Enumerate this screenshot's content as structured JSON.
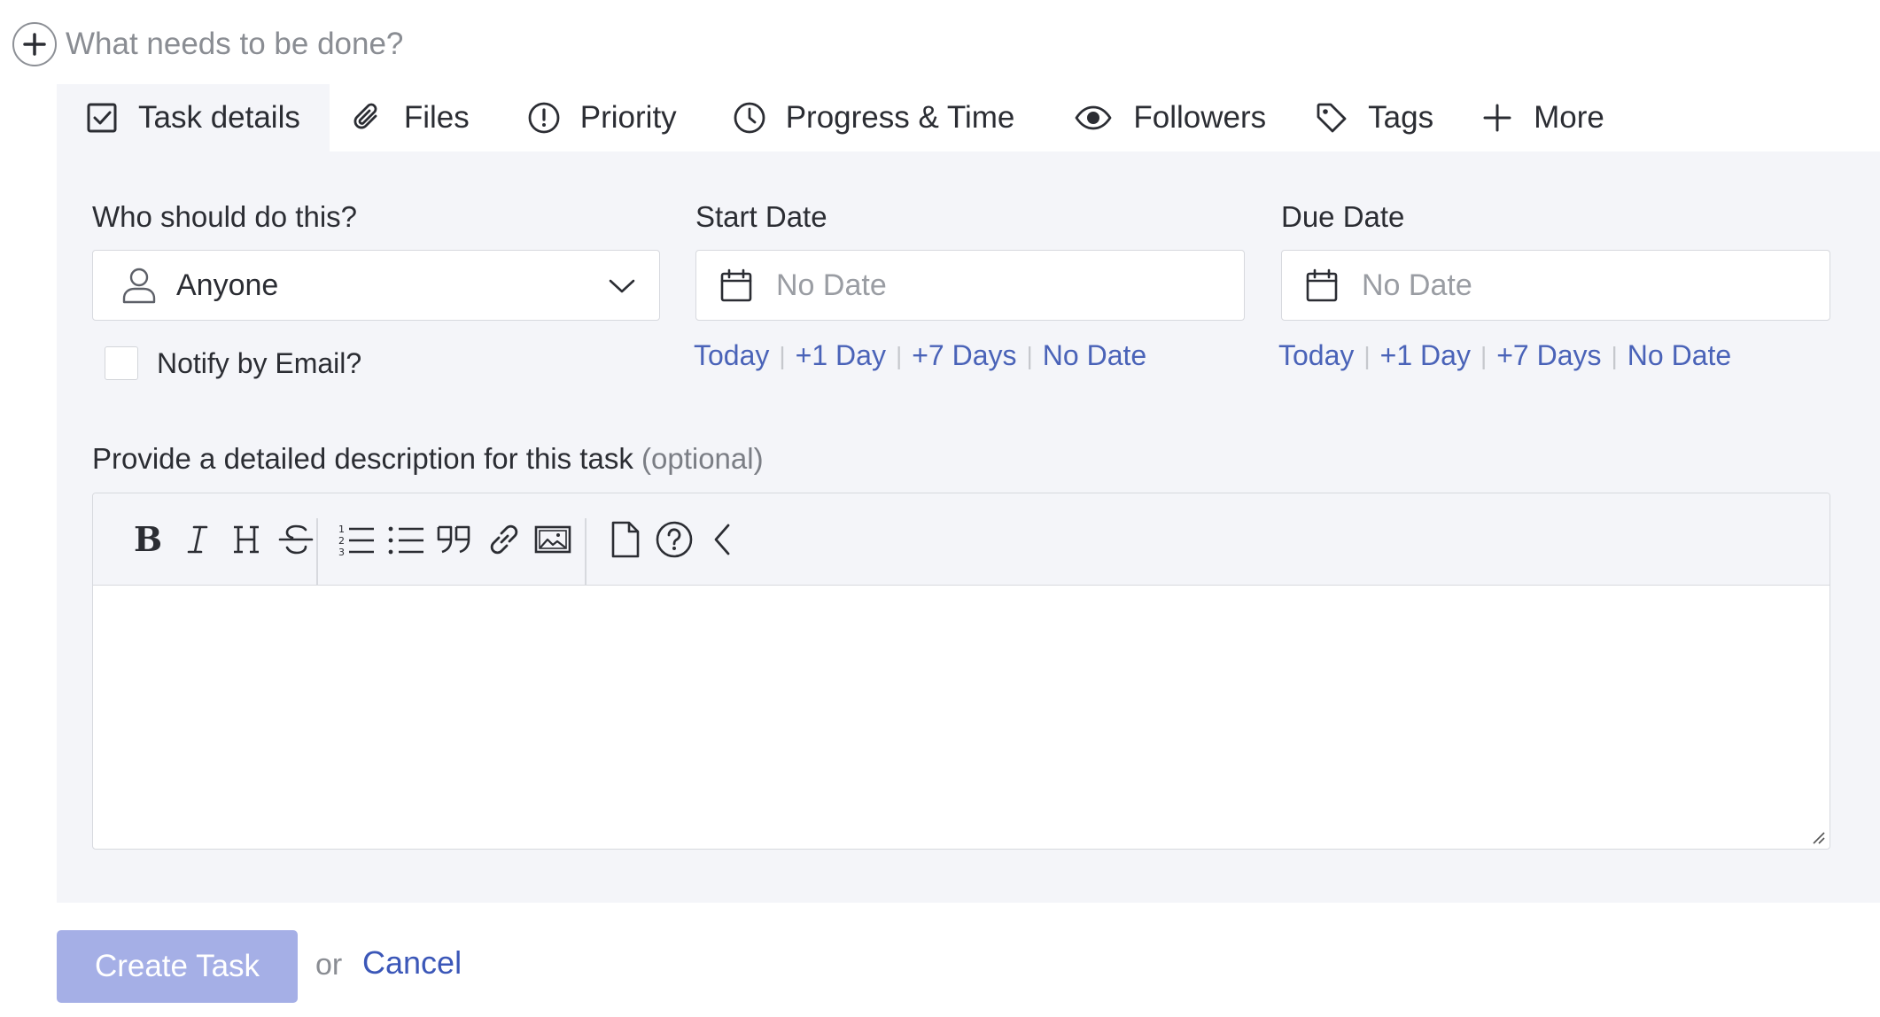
{
  "task_input": {
    "placeholder": "What needs to be done?",
    "value": ""
  },
  "tabs": [
    {
      "label": "Task details",
      "icon": "checkbox-icon",
      "active": true
    },
    {
      "label": "Files",
      "icon": "paperclip-icon"
    },
    {
      "label": "Priority",
      "icon": "exclamation-circle-icon"
    },
    {
      "label": "Progress & Time",
      "icon": "clock-icon"
    },
    {
      "label": "Followers",
      "icon": "eye-icon"
    },
    {
      "label": "Tags",
      "icon": "tag-icon"
    },
    {
      "label": "More",
      "icon": "plus-icon"
    }
  ],
  "assignee": {
    "label": "Who should do this?",
    "value": "Anyone",
    "icon": "person-icon"
  },
  "start_date": {
    "label": "Start Date",
    "placeholder": "No Date",
    "quick_links": [
      "Today",
      "+1 Day",
      "+7 Days",
      "No Date"
    ]
  },
  "due_date": {
    "label": "Due Date",
    "placeholder": "No Date",
    "quick_links": [
      "Today",
      "+1 Day",
      "+7 Days",
      "No Date"
    ]
  },
  "notify": {
    "label": "Notify by Email?",
    "checked": false
  },
  "description": {
    "label": "Provide a detailed description for this task",
    "optional": "(optional)",
    "value": ""
  },
  "toolbar": {
    "buttons": [
      "bold-icon",
      "italic-icon",
      "heading-icon",
      "strikethrough-icon",
      "ordered-list-icon",
      "bullet-list-icon",
      "quote-icon",
      "link-icon",
      "image-icon",
      "file-icon",
      "help-icon",
      "collapse-icon"
    ]
  },
  "footer": {
    "create_label": "Create Task",
    "or": "or",
    "cancel_label": "Cancel"
  },
  "colors": {
    "panel_bg": "#f4f5f9",
    "link": "#4a63b8",
    "create_button": "#a5afe6"
  }
}
